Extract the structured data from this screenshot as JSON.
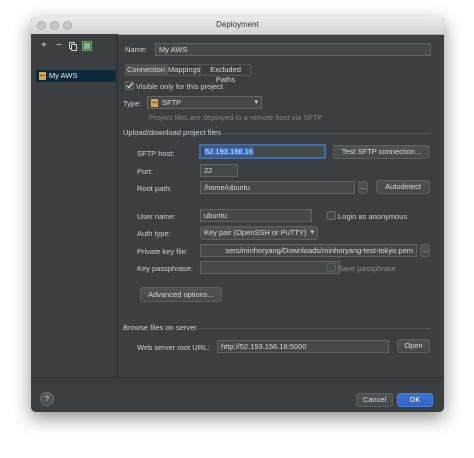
{
  "window": {
    "title": "Deployment"
  },
  "toolbar": {
    "add": "+",
    "remove": "−"
  },
  "servers": [
    {
      "name": "My AWS"
    }
  ],
  "name": {
    "label": "Name:",
    "value": "My AWS"
  },
  "tabs": [
    {
      "label": "Connection"
    },
    {
      "label": "Mappings"
    },
    {
      "label": "Excluded Paths"
    }
  ],
  "visible_only": {
    "label": "Visible only for this project",
    "checked": true
  },
  "type": {
    "label": "Type:",
    "value": "SFTP",
    "hint": "Project files are deployed to a remote host via SFTP"
  },
  "upload_section": {
    "label": "Upload/download project files"
  },
  "sftp_host": {
    "label": "SFTP host:",
    "value": "52.193.156.16",
    "test_button": "Test SFTP connection..."
  },
  "port": {
    "label": "Port:",
    "value": "22"
  },
  "root_path": {
    "label": "Root path:",
    "value": "/home/ubuntu",
    "browse": "...",
    "autodetect": "Autodetect"
  },
  "user_name": {
    "label": "User name:",
    "value": "ubuntu"
  },
  "anonymous": {
    "label": "Login as anonymous",
    "checked": false
  },
  "auth_type": {
    "label": "Auth type:",
    "value": "Key pair (OpenSSH or PuTTY)"
  },
  "private_key": {
    "label": "Private key file:",
    "value": "sers/minhoryang/Downloads/minhoryang-test-tokyo.pem",
    "browse": "..."
  },
  "key_passphrase": {
    "label": "Key passphrase:",
    "value": ""
  },
  "save_passphrase": {
    "label": "Save passphrase",
    "checked": false
  },
  "advanced_button": "Advanced options...",
  "browse_section": {
    "label": "Browse files on server"
  },
  "web_root": {
    "label": "Web server root URL:",
    "value": "http://52.193.156.16:5000",
    "open": "Open"
  },
  "footer": {
    "help": "?",
    "cancel": "Cancel",
    "ok": "OK"
  },
  "colors": {
    "accent": "#2f65ca",
    "panel": "#3c3f41",
    "selection": "#0d293e"
  }
}
